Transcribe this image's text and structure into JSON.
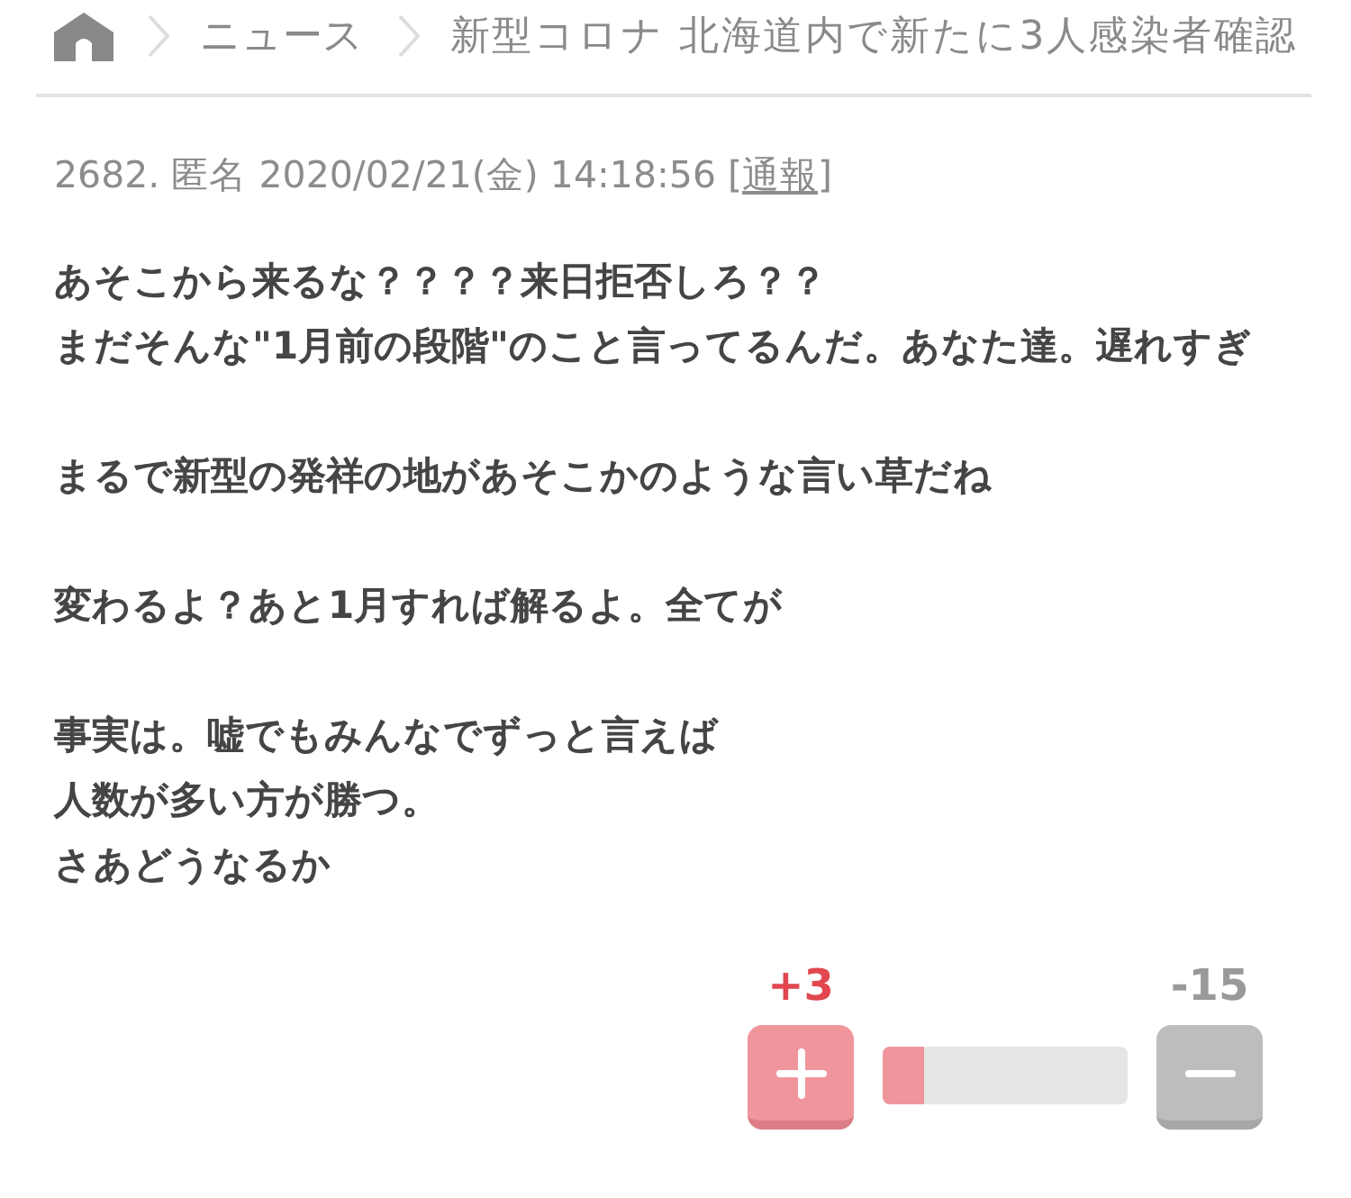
{
  "breadcrumb": [
    "ニュース",
    "新型コロナ 北海道内で新たに3人感染者確認"
  ],
  "comment": {
    "number": "2682.",
    "author": "匿名",
    "posted": "2020/02/21(金) 14:18:56",
    "report": {
      "open": "[",
      "label": "通報",
      "close": "]"
    },
    "paragraphs": [
      [
        "あそこから来るな？？？？来日拒否しろ？？",
        "まだそんな\"1月前の段階\"のこと言ってるんだ。あなた達。遅れすぎ"
      ],
      [
        "まるで新型の発祥の地があそこかのような言い草だね"
      ],
      [
        "変わるよ？あと1月すれば解るよ。全てが"
      ],
      [
        "事実は。嘘でもみんなでずっと言えば",
        "人数が多い方が勝つ。",
        "さあどうなるか"
      ]
    ]
  },
  "votes": {
    "up": "+3",
    "down": "-15",
    "level": 0.17
  }
}
